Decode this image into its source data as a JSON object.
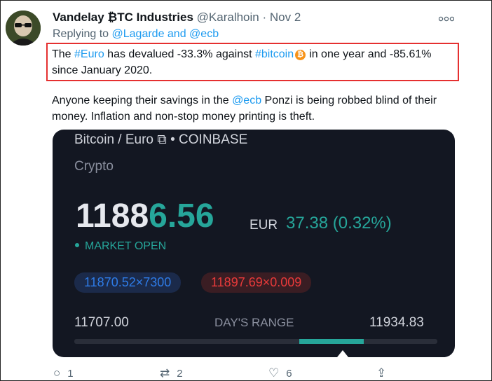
{
  "tweet": {
    "author_name": "Vandelay ₿TC Industries",
    "handle": "@Karalhoin",
    "separator": "·",
    "date": "Nov 2",
    "more_icon": "more-icon",
    "reply_prefix": "Replying to ",
    "reply_targets": "@Lagarde and @ecb",
    "text1_part1": "The ",
    "text1_hashtag1": "#Euro",
    "text1_part2": " has devalued -33.3% against ",
    "text1_hashtag2": "#bitcoin",
    "text1_btc_glyph": "₿",
    "text1_part3": "in one year and -85.61% since January 2020.",
    "text2_part1": "Anyone keeping their savings in the ",
    "text2_mention": "@ecb",
    "text2_part2": " Ponzi is being robbed blind of their money. Inflation and non-stop money printing is theft."
  },
  "card": {
    "title": "Bitcoin / Euro ⧉ • COINBASE",
    "subtitle": "Crypto",
    "price_main": "1188",
    "price_accent": "6.56",
    "currency": "EUR",
    "change": "37.38 (0.32%)",
    "market_status": "MARKET OPEN",
    "bid": "11870.52×7300",
    "ask": "11897.69×0.009",
    "day_low": "11707.00",
    "day_range_label": "DAY'S RANGE",
    "day_high": "11934.83"
  },
  "actions": {
    "reply_icon": "○",
    "reply_count": "1",
    "retweet_icon": "⇄",
    "retweet_count": "2",
    "like_icon": "♡",
    "like_count": "6",
    "share_icon": "⇪"
  },
  "colors": {
    "link": "#1d9bf0",
    "highlight_box": "#e53030",
    "up_green": "#26a69a",
    "bid_blue": "#2e7be6",
    "ask_red": "#e83a3a",
    "card_bg": "#131722",
    "bitcoin_orange": "#f7931a"
  }
}
